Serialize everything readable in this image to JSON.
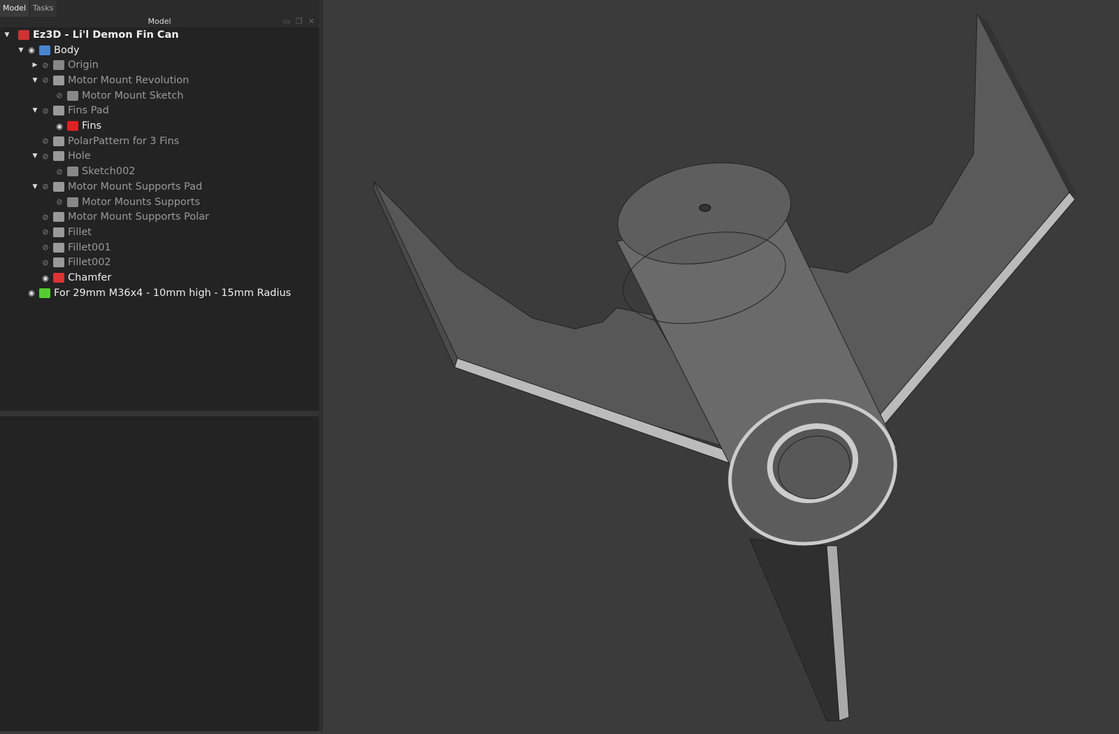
{
  "tabs": [
    "Model",
    "Tasks"
  ],
  "panel_title": "Model",
  "tree": [
    {
      "label": "Ez3D - Li'l Demon Fin Can",
      "depth": 0,
      "arrow": "down",
      "eye": false,
      "icon": "document-icon",
      "visible": true,
      "bold": true,
      "color": "#c33"
    },
    {
      "label": "Body",
      "depth": 1,
      "arrow": "down",
      "eye": "shown",
      "icon": "body-icon",
      "visible": true,
      "color": "#4a86d0"
    },
    {
      "label": "Origin",
      "depth": 2,
      "arrow": "right",
      "eye": "hidden",
      "icon": "origin-icon",
      "color": "#888"
    },
    {
      "label": "Motor Mount Revolution",
      "depth": 2,
      "arrow": "down",
      "eye": "hidden",
      "icon": "revolution-icon",
      "color": "#999"
    },
    {
      "label": "Motor Mount Sketch",
      "depth": 3,
      "eye": "hidden",
      "icon": "sketch-icon",
      "color": "#888"
    },
    {
      "label": "Fins Pad",
      "depth": 2,
      "arrow": "down",
      "eye": "hidden",
      "icon": "pad-icon",
      "color": "#999"
    },
    {
      "label": "Fins",
      "depth": 3,
      "eye": "shown",
      "icon": "sketch-icon",
      "visible": true,
      "color": "#d22"
    },
    {
      "label": "PolarPattern for 3 Fins",
      "depth": 2,
      "eye": "hidden",
      "icon": "polar-pattern-icon",
      "color": "#999"
    },
    {
      "label": "Hole",
      "depth": 2,
      "arrow": "down",
      "eye": "hidden",
      "icon": "hole-icon",
      "color": "#999"
    },
    {
      "label": "Sketch002",
      "depth": 3,
      "eye": "hidden",
      "icon": "sketch-icon",
      "color": "#888"
    },
    {
      "label": "Motor Mount Supports Pad",
      "depth": 2,
      "arrow": "down",
      "eye": "hidden",
      "icon": "pad-icon",
      "color": "#999"
    },
    {
      "label": "Motor Mounts Supports",
      "depth": 3,
      "eye": "hidden",
      "icon": "sketch-icon",
      "color": "#888"
    },
    {
      "label": "Motor Mount Supports Polar",
      "depth": 2,
      "eye": "hidden",
      "icon": "polar-pattern-icon",
      "color": "#999"
    },
    {
      "label": "Fillet",
      "depth": 2,
      "eye": "hidden",
      "icon": "fillet-icon",
      "color": "#999"
    },
    {
      "label": "Fillet001",
      "depth": 2,
      "eye": "hidden",
      "icon": "fillet-icon",
      "color": "#999"
    },
    {
      "label": "Fillet002",
      "depth": 2,
      "eye": "hidden",
      "icon": "fillet-icon",
      "color": "#999"
    },
    {
      "label": "Chamfer",
      "depth": 2,
      "eye": "shown",
      "icon": "chamfer-icon",
      "visible": true,
      "color": "#d33"
    },
    {
      "label": "For 29mm M36x4 - 10mm high - 15mm Radius",
      "depth": 1,
      "eye": "shown",
      "icon": "thread-icon",
      "visible": true,
      "color": "#5c3"
    }
  ]
}
